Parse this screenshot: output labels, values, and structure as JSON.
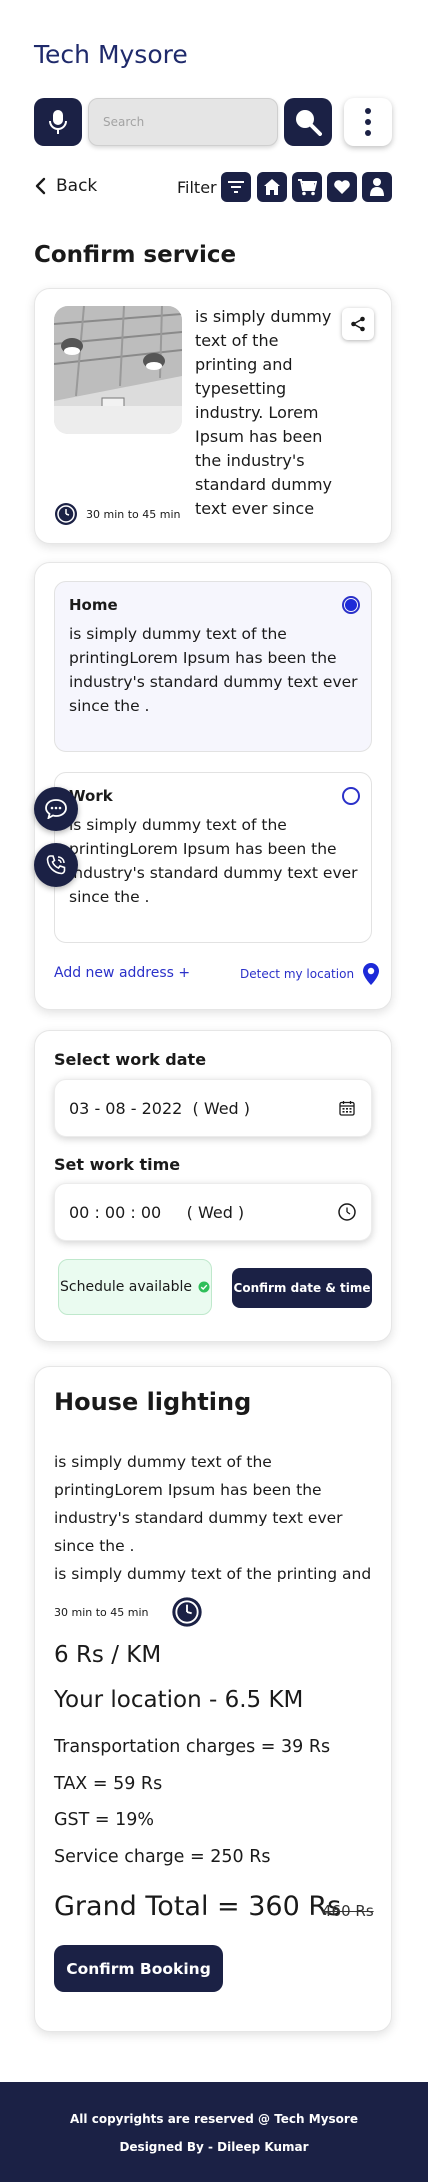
{
  "brand": "Tech Mysore",
  "search": {
    "placeholder": "Search"
  },
  "nav": {
    "back_label": "Back",
    "filter_label": "Filter"
  },
  "filter_icons": [
    "sliders-icon",
    "home-icon",
    "cart-icon",
    "heart-icon",
    "user-icon"
  ],
  "page_title": "Confirm service",
  "service": {
    "description": "is simply dummy text of the printing and typesetting industry. Lorem Ipsum has been the industry's standard dummy text ever since",
    "duration": "30 min to 45 min"
  },
  "addresses": [
    {
      "title": "Home",
      "text": "is simply dummy text of the printingLorem Ipsum has been the industry's standard dummy text ever since the .",
      "selected": true
    },
    {
      "title": "Work",
      "text": "is simply dummy text of the printingLorem Ipsum has been the industry's standard dummy text ever since the .",
      "selected": false
    }
  ],
  "address_actions": {
    "add_new": "Add new address +",
    "detect": "Detect my location"
  },
  "schedule": {
    "date_label": "Select work date",
    "date_value": "03 - 08 - 2022  ( Wed )",
    "time_label": "Set work time",
    "time_value": "00 : 00 : 00     ( Wed )",
    "status": "Schedule available",
    "confirm_label": "Confirm date & time"
  },
  "summary": {
    "title": "House lighting",
    "desc1": "is simply dummy text of the printingLorem Ipsum has been the industry's standard dummy text ever since the .",
    "desc2": "is simply dummy text of the printing and",
    "duration": "30 min to 45 min",
    "rate": "6 Rs / KM",
    "location": "Your location - 6.5 KM",
    "transport": "Transportation charges = 39 Rs",
    "tax": "TAX = 59 Rs",
    "gst": "GST = 19%",
    "service_charge": "Service charge = 250 Rs",
    "grand_total": "Grand Total = 360 Rs",
    "old_price": "460 Rs",
    "book_label": "Confirm Booking"
  },
  "footer": {
    "copyright": "All copyrights are reserved @ Tech Mysore",
    "designer": "Designed By - Dileep Kumar"
  },
  "colors": {
    "navy": "#1b2145",
    "link_blue": "#2b31c9",
    "radio_blue": "#1d2ad8",
    "success_green": "#2fbf5a",
    "page_bg": "#ffffff"
  }
}
